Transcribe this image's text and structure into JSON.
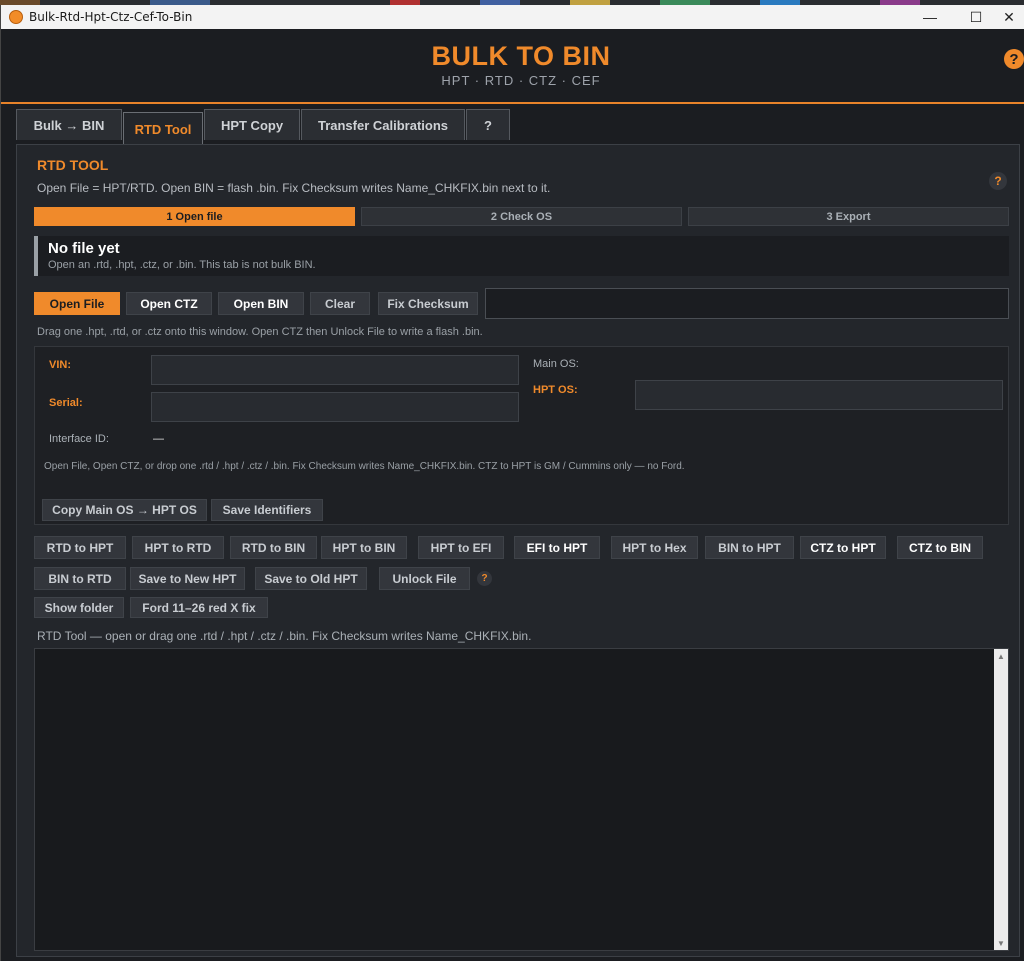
{
  "window": {
    "title": "Bulk-Rtd-Hpt-Ctz-Cef-To-Bin",
    "controls": {
      "minimize": "—",
      "maximize": "☐",
      "close": "✕"
    }
  },
  "header": {
    "brand": "BULK TO BIN",
    "subtitle": "HPT  ·  RTD  ·  CTZ  ·  CEF",
    "help": "?"
  },
  "tabs": [
    {
      "label": "Bulk → BIN",
      "active": false
    },
    {
      "label": "RTD Tool",
      "active": true
    },
    {
      "label": "HPT Copy",
      "active": false
    },
    {
      "label": "Transfer Calibrations",
      "active": false
    },
    {
      "label": "?",
      "active": false
    }
  ],
  "panel": {
    "title": "RTD TOOL",
    "description": "Open File = HPT/RTD. Open BIN = flash .bin. Fix Checksum writes Name_CHKFIX.bin next to it.",
    "help": "?",
    "steps": [
      {
        "label": "1  Open file",
        "active": true
      },
      {
        "label": "2  Check OS",
        "active": false
      },
      {
        "label": "3  Export",
        "active": false
      }
    ],
    "notice": {
      "heading": "No file yet",
      "sub": "Open an .rtd, .hpt, .ctz, or .bin. This tab is not bulk BIN."
    },
    "file_buttons": {
      "open_file": "Open File",
      "open_ctz": "Open CTZ",
      "open_bin": "Open BIN",
      "clear": "Clear",
      "fix_checksum": "Fix Checksum"
    },
    "path_value": "",
    "drag_hint": "Drag one .hpt, .rtd, or .ctz onto this window. Open CTZ then Unlock File to write a flash .bin.",
    "identifiers": {
      "vin_label": "VIN:",
      "vin_value": "",
      "serial_label": "Serial:",
      "serial_value": "",
      "interface_label": "Interface ID:",
      "interface_value": "—",
      "main_os_label": "Main OS:",
      "main_os_value": "",
      "hpt_os_label": "HPT OS:",
      "hpt_os_value": "",
      "note": "Open File, Open CTZ, or drop one .rtd / .hpt / .ctz / .bin. Fix Checksum writes Name_CHKFIX.bin. CTZ to HPT is GM / Cummins only — no Ford.",
      "copy_os": "Copy Main OS → HPT OS",
      "save_ids": "Save Identifiers"
    },
    "convert_row1": [
      "RTD to HPT",
      "HPT to RTD",
      "RTD to BIN",
      "HPT to BIN",
      "HPT to EFI",
      "EFI to HPT",
      "HPT to Hex",
      "BIN to HPT",
      "CTZ to HPT",
      "CTZ to BIN"
    ],
    "convert_row2": [
      "BIN to RTD",
      "Save to New HPT",
      "Save to Old HPT",
      "Unlock File"
    ],
    "row2_help": "?",
    "misc": [
      "Show folder",
      "Ford 11–26 red X fix"
    ],
    "log_label": "RTD Tool — open or drag one .rtd / .hpt / .ctz / .bin. Fix Checksum writes Name_CHKFIX.bin.",
    "log_text": ""
  },
  "colors": {
    "accent": "#f08a2b",
    "background": "#1b1d21",
    "panel": "#23262b"
  }
}
